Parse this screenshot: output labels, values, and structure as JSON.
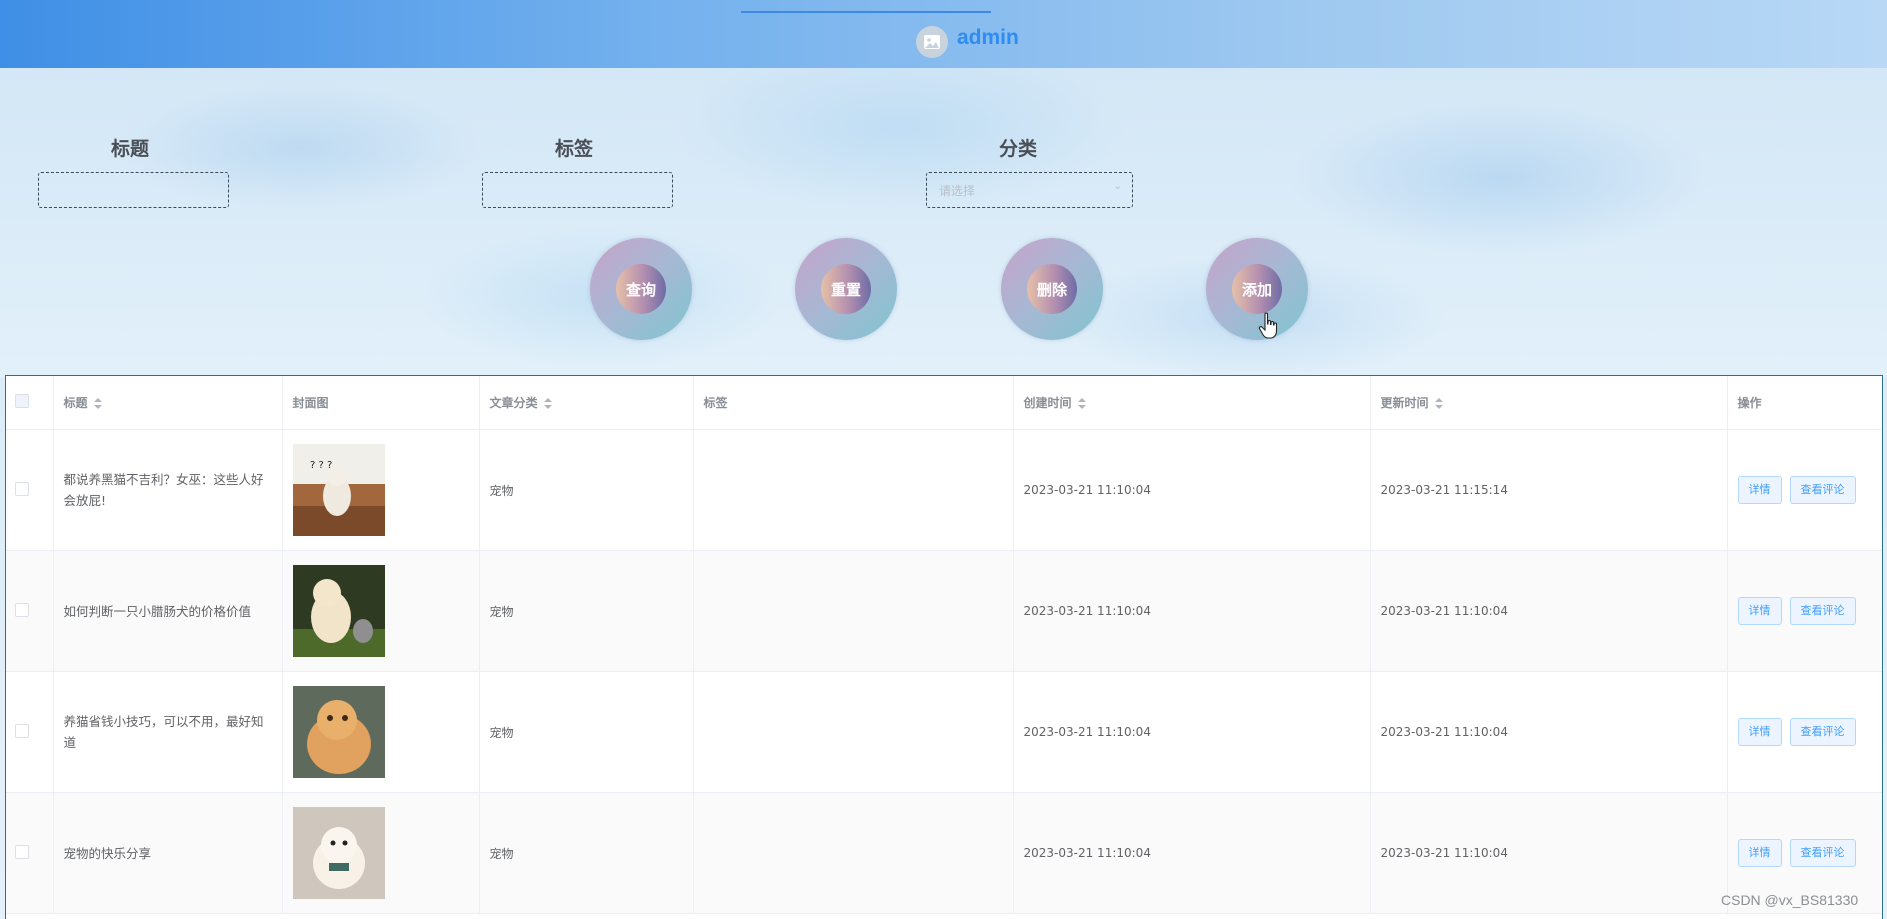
{
  "header": {
    "username": "admin"
  },
  "search": {
    "title_label": "标题",
    "tag_label": "标签",
    "category_label": "分类",
    "title_value": "",
    "tag_value": "",
    "category_placeholder": "请选择"
  },
  "actions": {
    "query": "查询",
    "reset": "重置",
    "delete": "删除",
    "add": "添加"
  },
  "table": {
    "columns": {
      "title": "标题",
      "cover": "封面图",
      "category": "文章分类",
      "tags": "标签",
      "created": "创建时间",
      "updated": "更新时间",
      "ops": "操作"
    },
    "rows": [
      {
        "title": "都说养黑猫不吉利？女巫：这些人好会放屁!",
        "category": "宠物",
        "tags": "",
        "created": "2023-03-21 11:10:04",
        "updated": "2023-03-21 11:15:14",
        "detail": "详情",
        "comments": "查看评论"
      },
      {
        "title": "如何判断一只小腊肠犬的价格价值",
        "category": "宠物",
        "tags": "",
        "created": "2023-03-21 11:10:04",
        "updated": "2023-03-21 11:10:04",
        "detail": "详情",
        "comments": "查看评论"
      },
      {
        "title": "养猫省钱小技巧，可以不用，最好知道",
        "category": "宠物",
        "tags": "",
        "created": "2023-03-21 11:10:04",
        "updated": "2023-03-21 11:10:04",
        "detail": "详情",
        "comments": "查看评论"
      },
      {
        "title": "宠物的快乐分享",
        "category": "宠物",
        "tags": "",
        "created": "2023-03-21 11:10:04",
        "updated": "2023-03-21 11:10:04",
        "detail": "详情",
        "comments": "查看评论"
      }
    ]
  },
  "watermark": "CSDN @vx_BS81330"
}
